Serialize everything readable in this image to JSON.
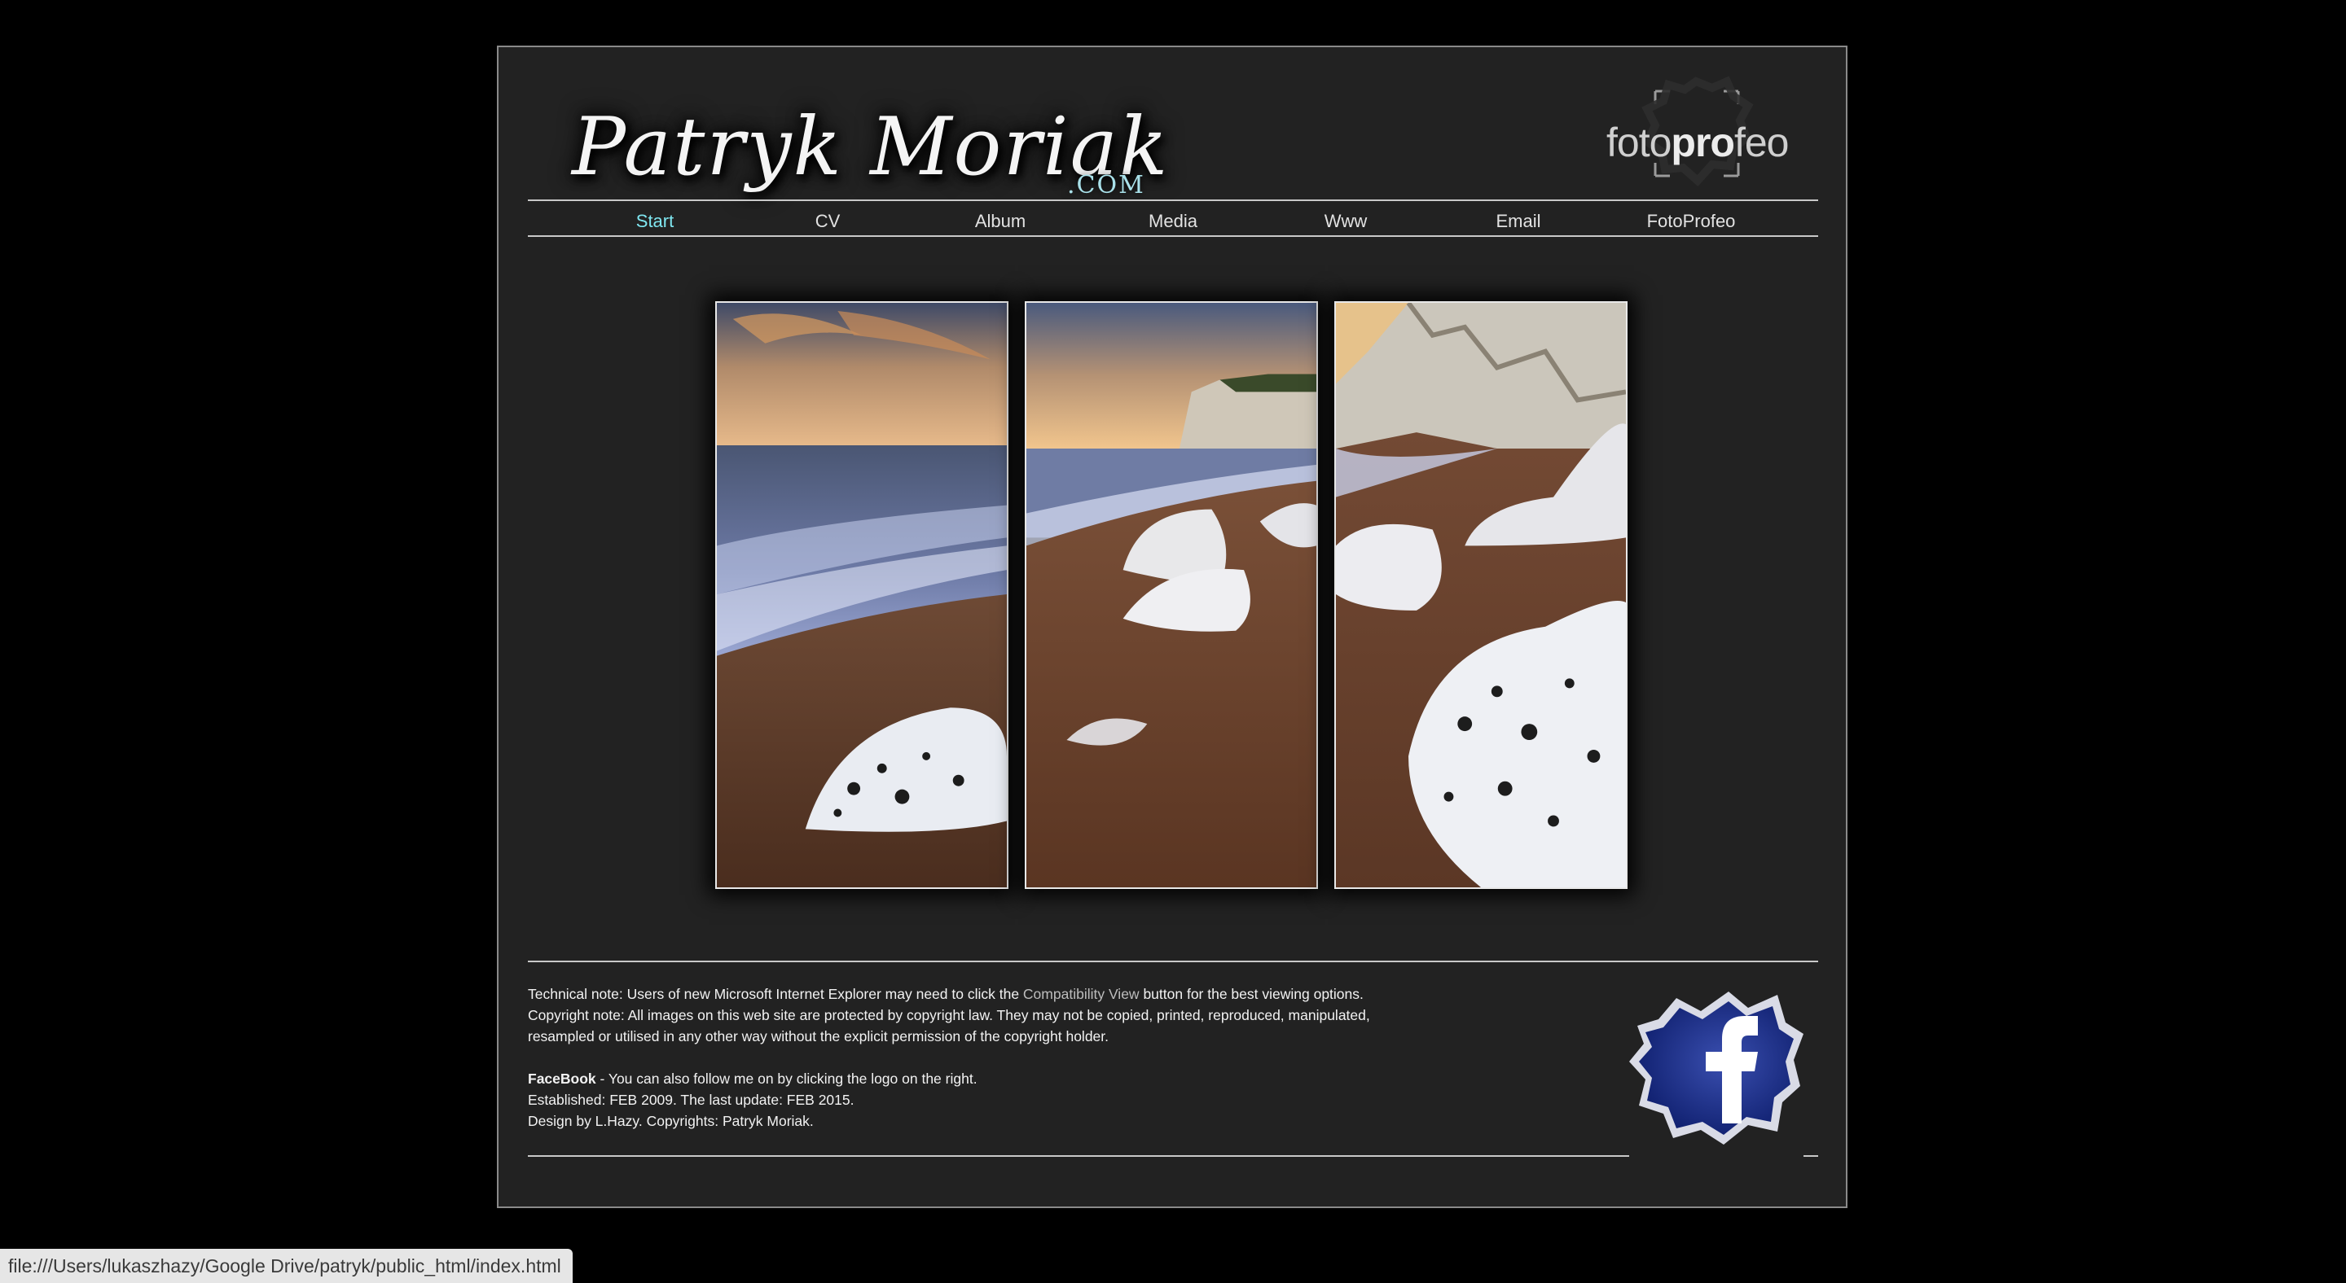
{
  "header": {
    "logo_script": "Patryk Moriak",
    "logo_suffix": ".COM",
    "brand_prefix": "foto",
    "brand_bold": "pro",
    "brand_suffix": "feo"
  },
  "nav": {
    "items": [
      {
        "label": "Start",
        "active": true
      },
      {
        "label": "CV"
      },
      {
        "label": "Album"
      },
      {
        "label": "Media"
      },
      {
        "label": "Www"
      },
      {
        "label": "Email"
      },
      {
        "label": "FotoProfeo"
      }
    ]
  },
  "footer": {
    "technical_note_before": "Technical note: Users of new Microsoft Internet Explorer may need to click the ",
    "technical_note_link": "Compatibility View",
    "technical_note_after": " button for the best viewing options.",
    "copyright_line1": "Copyright note: All images on this web site are protected by copyright law. They may not be copied, printed, reproduced, manipulated,",
    "copyright_line2": "resampled or utilised in any other way without the explicit permission of the copyright holder.",
    "facebook_label": "FaceBook",
    "facebook_text": " - You can also follow me on by clicking the logo on the right.",
    "established": "Established: FEB 2009. The last update: FEB 2015.",
    "design": "Design by L.Hazy. Copyrights: Patryk Moriak.",
    "facebook_icon": "facebook-icon"
  },
  "statusbar": {
    "url": "file:///Users/lukaszhazy/Google Drive/patryk/public_html/index.html"
  },
  "colors": {
    "page_background": "#000000",
    "frame_background": "#222222",
    "nav_active": "#7fe6f0",
    "link": "#bdbdbd"
  }
}
